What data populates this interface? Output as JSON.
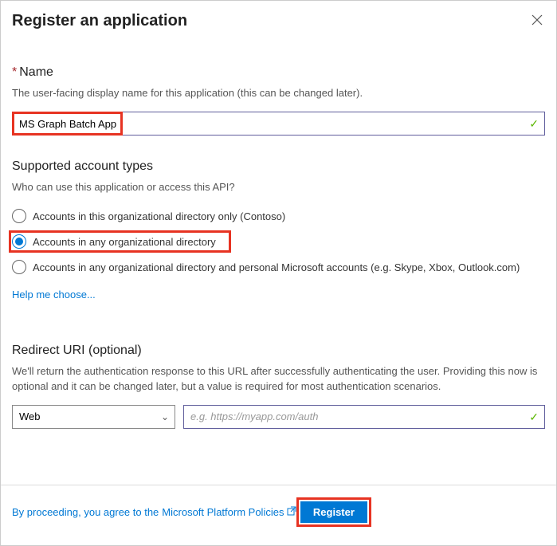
{
  "header": {
    "title": "Register an application"
  },
  "name_section": {
    "label": "Name",
    "helper": "The user-facing display name for this application (this can be changed later).",
    "value": "MS Graph Batch App"
  },
  "account_types": {
    "label": "Supported account types",
    "question": "Who can use this application or access this API?",
    "options": [
      {
        "label": "Accounts in this organizational directory only (Contoso)",
        "selected": false
      },
      {
        "label": "Accounts in any organizational directory",
        "selected": true
      },
      {
        "label": "Accounts in any organizational directory and personal Microsoft accounts (e.g. Skype, Xbox, Outlook.com)",
        "selected": false
      }
    ],
    "help_link": "Help me choose..."
  },
  "redirect": {
    "label": "Redirect URI (optional)",
    "helper": "We'll return the authentication response to this URL after successfully authenticating the user. Providing this now is optional and it can be changed later, but a value is required for most authentication scenarios.",
    "platform_selected": "Web",
    "uri_placeholder": "e.g. https://myapp.com/auth"
  },
  "footer": {
    "policy_prefix": "By proceeding, you agree to the ",
    "policy_link": "Microsoft Platform Policies",
    "register_button": "Register"
  }
}
